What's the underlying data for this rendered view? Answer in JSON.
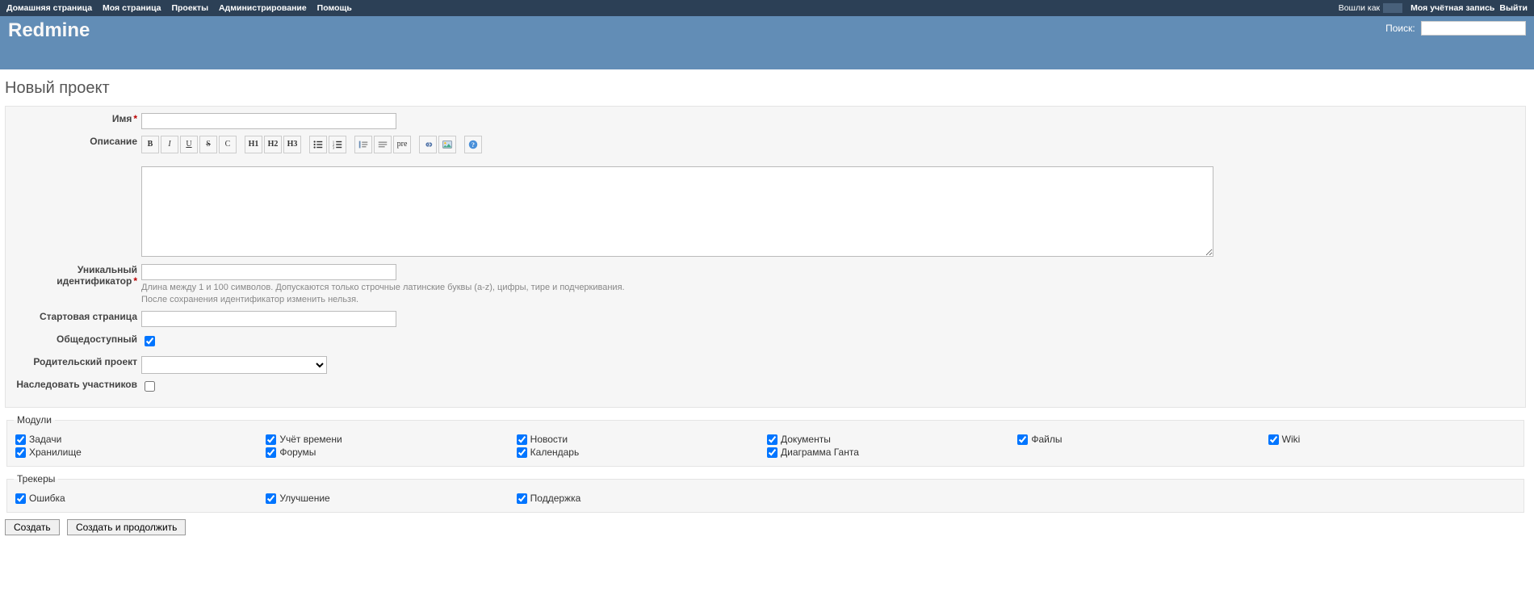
{
  "topmenu": {
    "left": [
      "Домашняя страница",
      "Моя страница",
      "Проекты",
      "Администрирование",
      "Помощь"
    ],
    "logged_as": "Вошли как",
    "right": [
      "Моя учётная запись",
      "Выйти"
    ]
  },
  "header": {
    "app_title": "Redmine",
    "search_label": "Поиск:",
    "search_value": ""
  },
  "page": {
    "title": "Новый проект"
  },
  "labels": {
    "name": "Имя",
    "description": "Описание",
    "identifier": "Уникальный идентификатор",
    "homepage": "Стартовая страница",
    "public": "Общедоступный",
    "parent": "Родительский проект",
    "inherit": "Наследовать участников"
  },
  "fields": {
    "name": "",
    "identifier": "",
    "homepage": "",
    "public_checked": true,
    "parent_value": "",
    "inherit_checked": false
  },
  "toolbar": {
    "bold": "B",
    "italic": "I",
    "underline": "U",
    "strike": "S",
    "code": "C",
    "h1": "H1",
    "h2": "H2",
    "h3": "H3",
    "pre": "pre"
  },
  "identifier_hint_line1": "Длина между 1 и 100 символов. Допускаются только строчные латинские буквы (a-z), цифры, тире и подчеркивания.",
  "identifier_hint_line2": "После сохранения идентификатор изменить нельзя.",
  "modules": {
    "legend": "Модули",
    "items": [
      {
        "label": "Задачи",
        "checked": true
      },
      {
        "label": "Учёт времени",
        "checked": true
      },
      {
        "label": "Новости",
        "checked": true
      },
      {
        "label": "Документы",
        "checked": true
      },
      {
        "label": "Файлы",
        "checked": true
      },
      {
        "label": "Wiki",
        "checked": true
      },
      {
        "label": "Хранилище",
        "checked": true
      },
      {
        "label": "Форумы",
        "checked": true
      },
      {
        "label": "Календарь",
        "checked": true
      },
      {
        "label": "Диаграмма Ганта",
        "checked": true
      }
    ]
  },
  "trackers": {
    "legend": "Трекеры",
    "items": [
      {
        "label": "Ошибка",
        "checked": true
      },
      {
        "label": "Улучшение",
        "checked": true
      },
      {
        "label": "Поддержка",
        "checked": true
      }
    ]
  },
  "buttons": {
    "create": "Создать",
    "create_continue": "Создать и продолжить"
  }
}
